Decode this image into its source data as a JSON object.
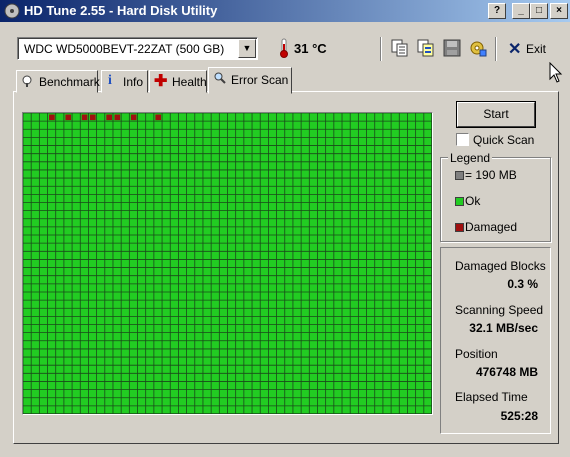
{
  "window": {
    "title": "HD Tune 2.55 - Hard Disk Utility",
    "controls": {
      "help": "?",
      "minimize": "_",
      "maximize": "□",
      "close": "×"
    }
  },
  "toolbar": {
    "drive": "WDC WD5000BEVT-22ZAT (500 GB)",
    "temperature": "31 °C",
    "exit_label": "Exit",
    "icons": [
      "copy-text-icon",
      "copy-info-icon",
      "save-icon",
      "options-icon"
    ]
  },
  "tabs": [
    {
      "label": "Benchmark",
      "icon": "benchmark-icon"
    },
    {
      "label": "Info",
      "icon": "info-icon"
    },
    {
      "label": "Health",
      "icon": "health-icon"
    },
    {
      "label": "Error Scan",
      "icon": "magnifier-icon",
      "active": true
    }
  ],
  "scan": {
    "start_label": "Start",
    "quick_scan_label": "Quick Scan",
    "quick_scan_checked": false,
    "grid": {
      "columns": 50,
      "rows": 37,
      "damaged_blocks": [
        [
          0,
          3
        ],
        [
          0,
          5
        ],
        [
          0,
          7
        ],
        [
          0,
          8
        ],
        [
          0,
          10
        ],
        [
          0,
          11
        ],
        [
          0,
          13
        ],
        [
          0,
          16
        ]
      ]
    }
  },
  "legend": {
    "title": "Legend",
    "items": [
      {
        "label": "= 190 MB",
        "color": "#808080"
      },
      {
        "label": "Ok",
        "color": "#22cc22"
      },
      {
        "label": "Damaged",
        "color": "#a01010"
      }
    ]
  },
  "stats": {
    "damaged_blocks_label": "Damaged Blocks",
    "damaged_blocks_value": "0.3 %",
    "scanning_speed_label": "Scanning Speed",
    "scanning_speed_value": "32.1 MB/sec",
    "position_label": "Position",
    "position_value": "476748 MB",
    "elapsed_time_label": "Elapsed Time",
    "elapsed_time_value": "525:28"
  },
  "colors": {
    "ok": "#22cc22",
    "damaged": "#a01010",
    "grid_line": "#1a4a1a"
  }
}
